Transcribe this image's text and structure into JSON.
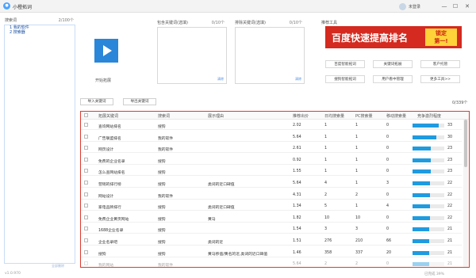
{
  "window": {
    "title": "小橙拓词",
    "user": "未登录",
    "controls": {
      "minimize": "—",
      "maximize": "☐",
      "close": "✕"
    },
    "logo_icon": "orange-logo-icon"
  },
  "sidebar": {
    "title": "搜索词",
    "count": "2/100个",
    "items": [
      "1 我的软件",
      "2 搜索器"
    ],
    "footer": "全部删除"
  },
  "start": {
    "label": "开始拓展",
    "icon": "play-icon",
    "accent": "#2a86d8"
  },
  "include_panel": {
    "label": "包含关键词(选填)",
    "count": "0/10个",
    "clear": "清除"
  },
  "exclude_panel": {
    "label": "排除关键词(选填)",
    "count": "0/10个",
    "clear": "清除"
  },
  "tools": {
    "title": "推荐工具",
    "banner_text": "百度快速提高排名",
    "banner_badge": [
      "锁定",
      "第一!"
    ],
    "banner_color": "#d42a1f",
    "buttons": [
      "百度智能拓词",
      "关键词拓展",
      "客户托管",
      "搜狗智能拓词",
      "用户看中管理",
      "更多工具>>"
    ]
  },
  "actions": {
    "import": "导入关键词",
    "export": "导出关键词",
    "total": "0/339个"
  },
  "table": {
    "headers": [
      "拓展关键词",
      "搜索词",
      "展示理由",
      "推荐出价",
      "日均搜索量",
      "PC搜索量",
      "移动搜索量",
      "竞争激烈程度"
    ],
    "rows": [
      {
        "kw": "查询网站排名",
        "src": "搜狗",
        "reason": "",
        "bid": "2.02",
        "daily": "1",
        "pc": "1",
        "mobile": "0",
        "comp": 33
      },
      {
        "kw": "广告联盟排名",
        "src": "我的软件",
        "reason": "",
        "bid": "5.64",
        "daily": "1",
        "pc": "1",
        "mobile": "0",
        "comp": 30
      },
      {
        "kw": "网页设计",
        "src": "我的软件",
        "reason": "",
        "bid": "2.61",
        "daily": "1",
        "pc": "1",
        "mobile": "0",
        "comp": 23
      },
      {
        "kw": "免费的企业名录",
        "src": "搜狗",
        "reason": "",
        "bid": "0.92",
        "daily": "1",
        "pc": "1",
        "mobile": "0",
        "comp": 23
      },
      {
        "kw": "怎么查网站排名",
        "src": "搜狗",
        "reason": "",
        "bid": "1.55",
        "daily": "1",
        "pc": "1",
        "mobile": "0",
        "comp": 23
      },
      {
        "kw": "营销的排行榜",
        "src": "搜狗",
        "reason": "类词的近口碑值",
        "bid": "5.64",
        "daily": "4",
        "pc": "1",
        "mobile": "3",
        "comp": 22
      },
      {
        "kw": "网站设计",
        "src": "我的软件",
        "reason": "",
        "bid": "4.31",
        "daily": "2",
        "pc": "2",
        "mobile": "0",
        "comp": 22
      },
      {
        "kw": "家电品牌排行",
        "src": "搜狗",
        "reason": "类词的近口碑值",
        "bid": "1.34",
        "daily": "5",
        "pc": "1",
        "mobile": "4",
        "comp": 22
      },
      {
        "kw": "免费企业黄页网站",
        "src": "搜狗",
        "reason": "黄马",
        "bid": "1.82",
        "daily": "10",
        "pc": "10",
        "mobile": "0",
        "comp": 22
      },
      {
        "kw": "1688企业名录",
        "src": "搜狗",
        "reason": "",
        "bid": "1.54",
        "daily": "3",
        "pc": "3",
        "mobile": "0",
        "comp": 21
      },
      {
        "kw": "企业名录吧",
        "src": "搜狗",
        "reason": "类词的近",
        "bid": "1.51",
        "daily": "276",
        "pc": "210",
        "mobile": "66",
        "comp": 21
      },
      {
        "kw": "搜狗",
        "src": "搜狗",
        "reason": "黄马移值/黄名的近,类词的近口碑值",
        "bid": "1.46",
        "daily": "358",
        "pc": "337",
        "mobile": "20",
        "comp": 21
      },
      {
        "kw": "我的网站",
        "src": "我的软件",
        "reason": "",
        "bid": "5.64",
        "daily": "2",
        "pc": "2",
        "mobile": "0",
        "comp": 21
      }
    ],
    "bar_color": "#1f9be0",
    "border_color": "#e03a2e"
  },
  "status": {
    "version": "v1.0.970",
    "right": "已完成 39%"
  }
}
